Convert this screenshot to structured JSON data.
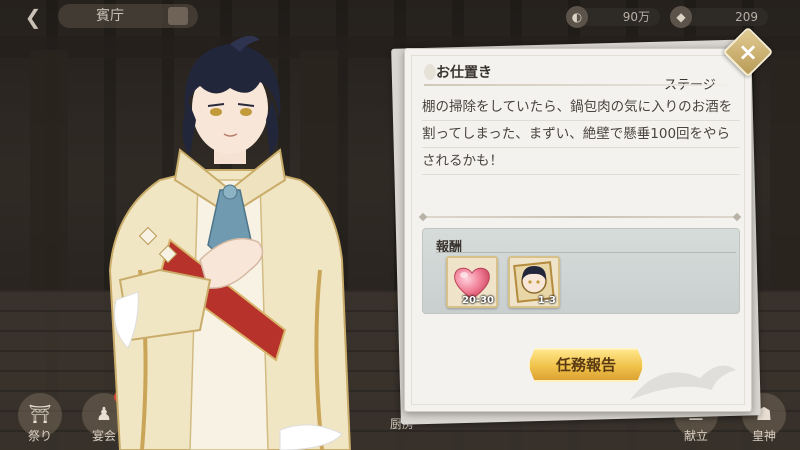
{
  "topbar": {
    "back_icon": "back-arrow-icon",
    "title": "賓庁",
    "gold_amount": "90万",
    "gem_amount": "209"
  },
  "bottom_nav": {
    "item1_label": "祭り",
    "item2_label": "宴会",
    "item2_alert": "!",
    "item3_label": "厨房",
    "item4_label": "献立",
    "item5_label": "皇神"
  },
  "dialog": {
    "title": "お仕置き",
    "stage_label": "ステージ",
    "description": "棚の掃除をしていたら、鍋包肉の気に入りのお酒を割ってしまった、まずい、絶壁で懸垂100回をやらされるかも！",
    "reward_title": "報酬",
    "rewards": [
      {
        "icon": "heart-icon",
        "quantity": "20-30"
      },
      {
        "icon": "character-portrait-icon",
        "quantity": "1-3"
      }
    ],
    "report_button": "任務報告",
    "close_icon": "close-icon"
  },
  "colors": {
    "accent_gold": "#f0c24a",
    "dialog_bg": "#f4f2ef",
    "reward_bg": "#d7dcdb"
  }
}
